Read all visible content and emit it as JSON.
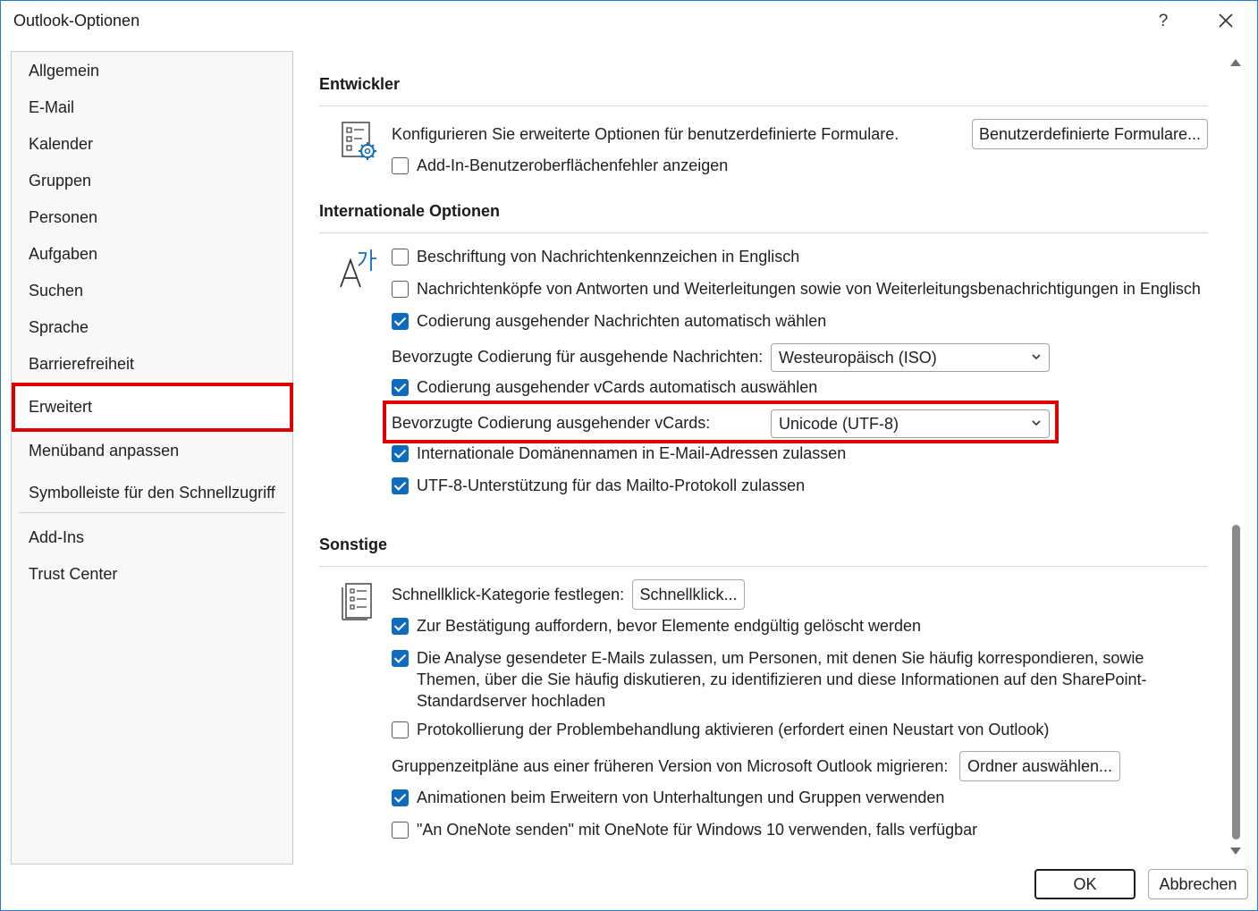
{
  "window": {
    "title": "Outlook-Optionen",
    "help": "?",
    "close": "✕"
  },
  "sidebar": {
    "items": [
      {
        "label": "Allgemein"
      },
      {
        "label": "E-Mail"
      },
      {
        "label": "Kalender"
      },
      {
        "label": "Gruppen"
      },
      {
        "label": "Personen"
      },
      {
        "label": "Aufgaben"
      },
      {
        "label": "Suchen"
      },
      {
        "label": "Sprache"
      },
      {
        "label": "Barrierefreiheit"
      },
      {
        "label": "Erweitert",
        "selected": true
      },
      {
        "label": "Menüband anpassen"
      },
      {
        "label": "Symbolleiste für den Schnellzugriff"
      },
      {
        "label": "Add-Ins"
      },
      {
        "label": "Trust Center"
      }
    ]
  },
  "developer": {
    "heading": "Entwickler",
    "description": "Konfigurieren Sie erweiterte Optionen für benutzerdefinierte Formulare.",
    "button": "Benutzerdefinierte Formulare...",
    "addin_errors": {
      "label": "Add-In-Benutzeroberflächenfehler anzeigen",
      "checked": false
    }
  },
  "international": {
    "heading": "Internationale Optionen",
    "flags_english": {
      "label": "Beschriftung von Nachrichtenkennzeichen in Englisch",
      "checked": false
    },
    "headers_english": {
      "label": "Nachrichtenköpfe von Antworten und Weiterleitungen sowie von Weiterleitungsbenachrichtigungen in Englisch",
      "checked": false
    },
    "auto_encoding": {
      "label": "Codierung ausgehender Nachrichten automatisch wählen",
      "checked": true
    },
    "preferred_encoding_label": "Bevorzugte Codierung für ausgehende Nachrichten:",
    "preferred_encoding_value": "Westeuropäisch (ISO)",
    "auto_vcard": {
      "label": "Codierung ausgehender vCards automatisch auswählen",
      "checked": true
    },
    "vcard_encoding_label": "Bevorzugte Codierung ausgehender vCards:",
    "vcard_encoding_value": "Unicode (UTF-8)",
    "idn": {
      "label": "Internationale Domänennamen in E-Mail-Adressen zulassen",
      "checked": true
    },
    "utf8_mailto": {
      "label": "UTF-8-Unterstützung für das Mailto-Protokoll zulassen",
      "checked": true
    }
  },
  "other": {
    "heading": "Sonstige",
    "quickclick_label": "Schnellklick-Kategorie festlegen:",
    "quickclick_button": "Schnellklick...",
    "confirm_delete": {
      "label": "Zur Bestätigung auffordern, bevor Elemente endgültig gelöscht werden",
      "checked": true
    },
    "analysis": {
      "label": "Die Analyse gesendeter E-Mails zulassen, um Personen, mit denen Sie häufig korrespondieren, sowie Themen, über die Sie häufig diskutieren, zu identifizieren und diese Informationen auf den SharePoint-Standardserver hochladen",
      "checked": true
    },
    "logging": {
      "label": "Protokollierung der Problembehandlung aktivieren (erfordert einen Neustart von Outlook)",
      "checked": false
    },
    "migrate_label": "Gruppenzeitpläne aus einer früheren Version von Microsoft Outlook migrieren:",
    "migrate_button": "Ordner auswählen...",
    "animations": {
      "label": "Animationen beim Erweitern von Unterhaltungen und Gruppen verwenden",
      "checked": true
    },
    "onenote": {
      "label": "\"An OneNote senden\" mit OneNote für Windows 10 verwenden, falls verfügbar",
      "checked": false
    }
  },
  "footer": {
    "ok": "OK",
    "cancel": "Abbrechen"
  },
  "colors": {
    "accent": "#0f6cbd",
    "highlight": "#e00000"
  }
}
